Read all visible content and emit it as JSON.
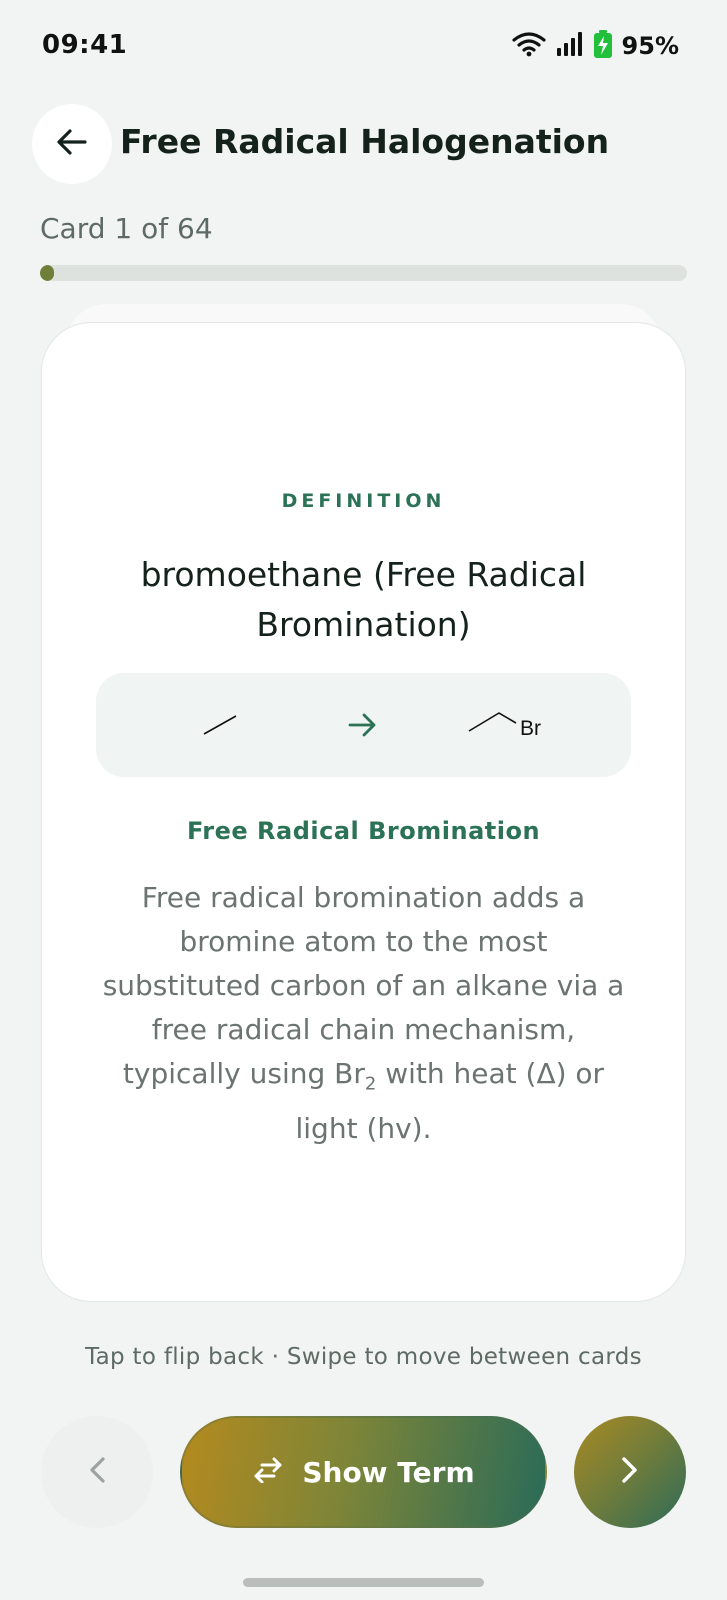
{
  "status_bar": {
    "time": "09:41",
    "battery": "95%",
    "icons": [
      "wifi-icon",
      "signal-icon",
      "battery-charging-icon"
    ]
  },
  "header": {
    "title": "Free Radical Halogenation",
    "back_icon": "arrow-left-icon"
  },
  "progress": {
    "counter": "Card 1 of 64",
    "current": 1,
    "total": 64
  },
  "card": {
    "label": "DEFINITION",
    "term": "bromoethane (Free Radical Bromination)",
    "reaction": {
      "product_atom": "Br"
    },
    "reaction_name": "Free Radical Bromination",
    "description_parts": {
      "before": "Free radical bromination adds a bromine atom to the most substituted carbon of an alkane via a free radical chain mechanism, typically using Br",
      "subscript": "2",
      "after": " with heat (Δ) or light (hv)."
    }
  },
  "hint": "Tap to flip back · Swipe to move between cards",
  "controls": {
    "prev_icon": "chevron-left-icon",
    "primary_label": "Show Term",
    "primary_icon": "swap-arrows-icon",
    "next_icon": "chevron-right-icon"
  },
  "colors": {
    "accent_green": "#2b7256",
    "accent_gold": "#b48a1e",
    "battery_green": "#22c03a"
  }
}
